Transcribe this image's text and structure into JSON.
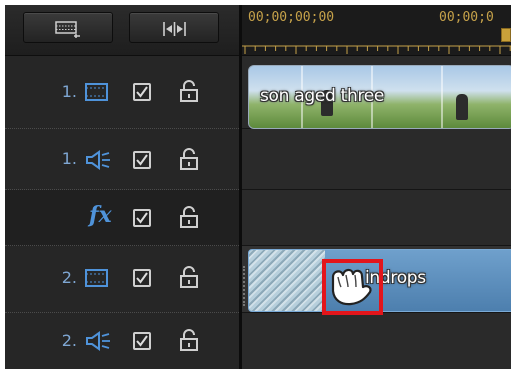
{
  "toolbar": {
    "buttons": [
      {
        "icon": "insert-track-icon"
      },
      {
        "icon": "fit-timeline-icon"
      }
    ]
  },
  "ruler": {
    "timecode_start": "00;00;00;00",
    "timecode_next": "00;00;0"
  },
  "tracks": [
    {
      "number": "1.",
      "type": "video",
      "icon": "video-track-icon",
      "enabled": true,
      "locked": false
    },
    {
      "number": "1.",
      "type": "audio",
      "icon": "audio-track-icon",
      "enabled": true,
      "locked": false
    },
    {
      "number": "",
      "type": "effect",
      "label": "fx",
      "enabled": true,
      "locked": false
    },
    {
      "number": "2.",
      "type": "video",
      "icon": "video-track-icon",
      "enabled": true,
      "locked": false
    },
    {
      "number": "2.",
      "type": "audio",
      "icon": "audio-track-icon",
      "enabled": true,
      "locked": false
    }
  ],
  "clips": [
    {
      "track": "video-1",
      "label": "son aged three"
    },
    {
      "track": "video-2",
      "label": "Raindrops",
      "visible_label": "indrops"
    }
  ],
  "colors": {
    "timecode": "#c6a24a",
    "track_number": "#7fa7d3",
    "fx": "#4f93da",
    "highlight": "#e3151b"
  },
  "cursor": {
    "icon": "grab-hand-cursor-icon"
  }
}
